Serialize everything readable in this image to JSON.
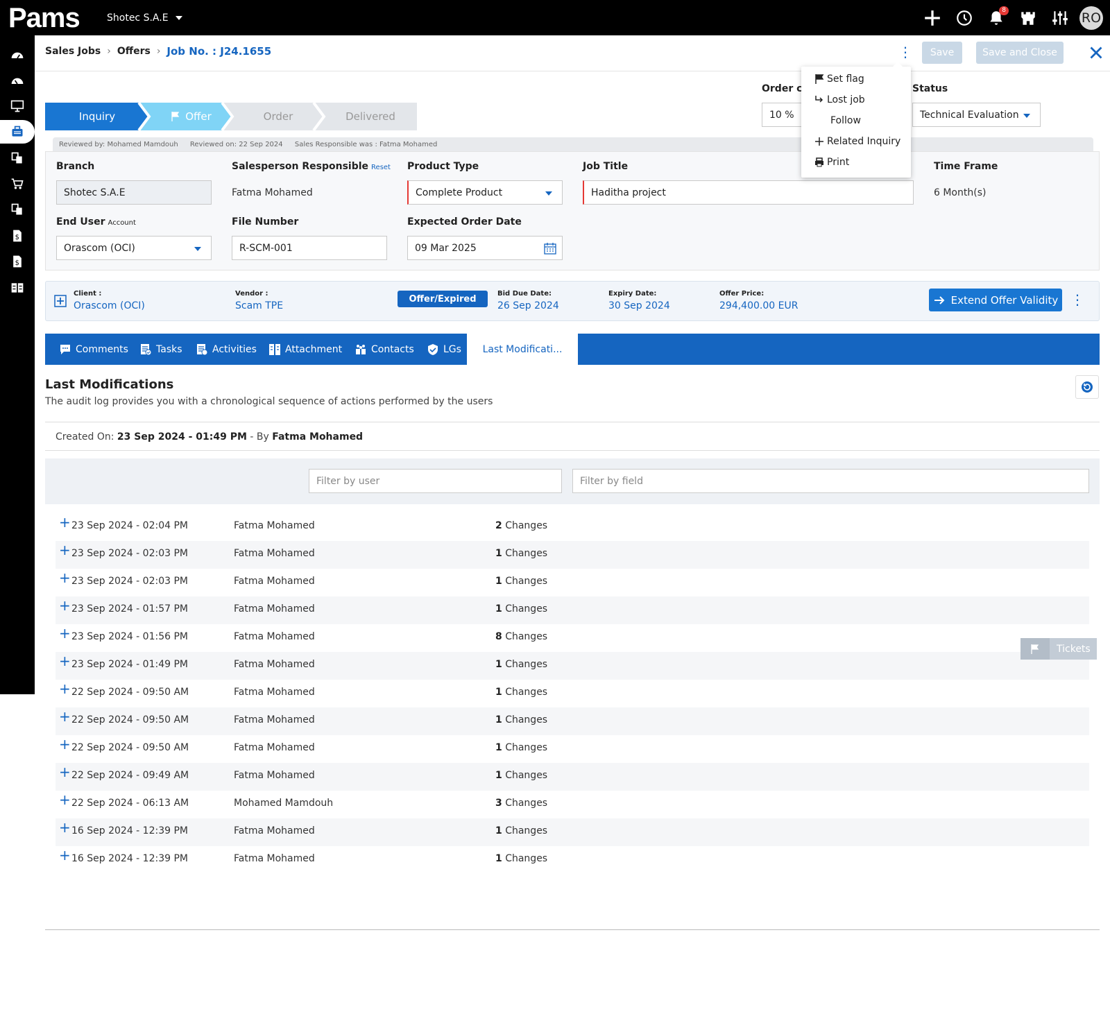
{
  "app": {
    "logo": "Pams",
    "company": "Shotec S.A.E",
    "notification_count": "8",
    "user_initials": "RO"
  },
  "breadcrumb": {
    "level1": "Sales Jobs",
    "level2": "Offers",
    "current": "Job No. : J24.1655"
  },
  "header_buttons": {
    "save": "Save",
    "save_close": "Save and Close"
  },
  "menu": {
    "set_flag": "Set flag",
    "lost_job": "Lost job",
    "follow": "Follow",
    "related_inquiry": "Related Inquiry",
    "print": "Print"
  },
  "stages": {
    "inquiry": "Inquiry",
    "offer": "Offer",
    "order": "Order",
    "delivered": "Delivered"
  },
  "top_fields": {
    "order_label": "Order ch",
    "order_value": "10 %",
    "status_label": "Status",
    "status_value": "Technical Evaluation"
  },
  "review": {
    "reviewed_by": "Reviewed by: Mohamed Mamdouh",
    "reviewed_on": "Reviewed on: 22 Sep 2024",
    "sales_resp": "Sales Responsible was : Fatma Mohamed"
  },
  "form": {
    "branch_label": "Branch",
    "branch_value": "Shotec S.A.E",
    "salesperson_label": "Salesperson Responsible",
    "reset": "Reset",
    "salesperson_value": "Fatma Mohamed",
    "product_label": "Product Type",
    "product_value": "Complete Product",
    "title_label": "Job Title",
    "title_value": "Haditha project",
    "timeframe_label": "Time Frame",
    "timeframe_value": "6 Month(s)",
    "enduser_label": "End User",
    "account": "Account",
    "enduser_value": "Orascom (OCI)",
    "file_label": "File Number",
    "file_value": "R-SCM-001",
    "expected_label": "Expected Order Date",
    "expected_value": "09 Mar 2025"
  },
  "info": {
    "client_label": "Client :",
    "client_value": "Orascom (OCI)",
    "vendor_label": "Vendor :",
    "vendor_value": "Scam TPE",
    "status_pill": "Offer/Expired",
    "bid_label": "Bid Due Date:",
    "bid_value": "26 Sep 2024",
    "expiry_label": "Expiry Date:",
    "expiry_value": "30 Sep 2024",
    "price_label": "Offer Price:",
    "price_value": "294,400.00 EUR",
    "extend": "Extend Offer Validity"
  },
  "tabs": {
    "comments": "Comments",
    "tasks": "Tasks",
    "activities": "Activities",
    "attachment": "Attachment",
    "contacts": "Contacts",
    "lgs": "LGs",
    "last": "Last Modificati..."
  },
  "section": {
    "title": "Last Modifications",
    "desc": "The audit log provides you with a chronological sequence of actions performed by the users",
    "created_prefix": "Created On:",
    "created_date": "23 Sep 2024 - 01:49 PM",
    "created_by": "- By",
    "created_user": "Fatma Mohamed",
    "filter_user": "Filter by user",
    "filter_field": "Filter by field",
    "changes_word": "Changes"
  },
  "log": [
    {
      "date": "23 Sep 2024 - 02:04 PM",
      "user": "Fatma Mohamed",
      "count": "2"
    },
    {
      "date": "23 Sep 2024 - 02:03 PM",
      "user": "Fatma Mohamed",
      "count": "1"
    },
    {
      "date": "23 Sep 2024 - 02:03 PM",
      "user": "Fatma Mohamed",
      "count": "1"
    },
    {
      "date": "23 Sep 2024 - 01:57 PM",
      "user": "Fatma Mohamed",
      "count": "1"
    },
    {
      "date": "23 Sep 2024 - 01:56 PM",
      "user": "Fatma Mohamed",
      "count": "8"
    },
    {
      "date": "23 Sep 2024 - 01:49 PM",
      "user": "Fatma Mohamed",
      "count": "1"
    },
    {
      "date": "22 Sep 2024 - 09:50 AM",
      "user": "Fatma Mohamed",
      "count": "1"
    },
    {
      "date": "22 Sep 2024 - 09:50 AM",
      "user": "Fatma Mohamed",
      "count": "1"
    },
    {
      "date": "22 Sep 2024 - 09:50 AM",
      "user": "Fatma Mohamed",
      "count": "1"
    },
    {
      "date": "22 Sep 2024 - 09:49 AM",
      "user": "Fatma Mohamed",
      "count": "1"
    },
    {
      "date": "22 Sep 2024 - 06:13 AM",
      "user": "Mohamed Mamdouh",
      "count": "3"
    },
    {
      "date": "16 Sep 2024 - 12:39 PM",
      "user": "Fatma Mohamed",
      "count": "1"
    },
    {
      "date": "16 Sep 2024 - 12:39 PM",
      "user": "Fatma Mohamed",
      "count": "1"
    }
  ],
  "tickets": "Tickets",
  "colors": {
    "primary": "#1565c0",
    "stage_active": "#1976d2",
    "stage_offer": "#80d4f6",
    "stage_inactive": "#e3e6ea",
    "required": "#e53935"
  }
}
